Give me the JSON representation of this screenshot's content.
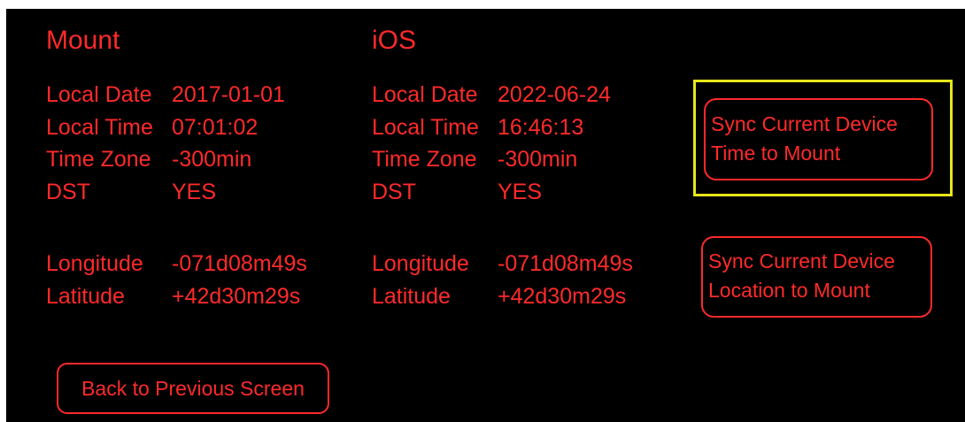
{
  "mount": {
    "heading": "Mount",
    "time": [
      {
        "label": "Local Date",
        "value": "2017-01-01"
      },
      {
        "label": "Local Time",
        "value": "07:01:02"
      },
      {
        "label": "Time Zone",
        "value": "-300min"
      },
      {
        "label": "DST",
        "value": "YES"
      }
    ],
    "location": [
      {
        "label": "Longitude",
        "value": "-071d08m49s"
      },
      {
        "label": "Latitude",
        "value": "+42d30m29s"
      }
    ]
  },
  "ios": {
    "heading": "iOS",
    "time": [
      {
        "label": "Local Date",
        "value": "2022-06-24"
      },
      {
        "label": "Local Time",
        "value": "16:46:13"
      },
      {
        "label": "Time Zone",
        "value": "-300min"
      },
      {
        "label": "DST",
        "value": "YES"
      }
    ],
    "location": [
      {
        "label": "Longitude",
        "value": "-071d08m49s"
      },
      {
        "label": "Latitude",
        "value": "+42d30m29s"
      }
    ]
  },
  "buttons": {
    "sync_time_line1": "Sync Current Device",
    "sync_time_line2": "Time to Mount",
    "sync_location_line1": "Sync Current Device",
    "sync_location_line2": "Location to Mount",
    "back": "Back to Previous Screen"
  },
  "colors": {
    "background": "#000000",
    "text": "#ff2a2a",
    "highlight": "#e6e619"
  }
}
